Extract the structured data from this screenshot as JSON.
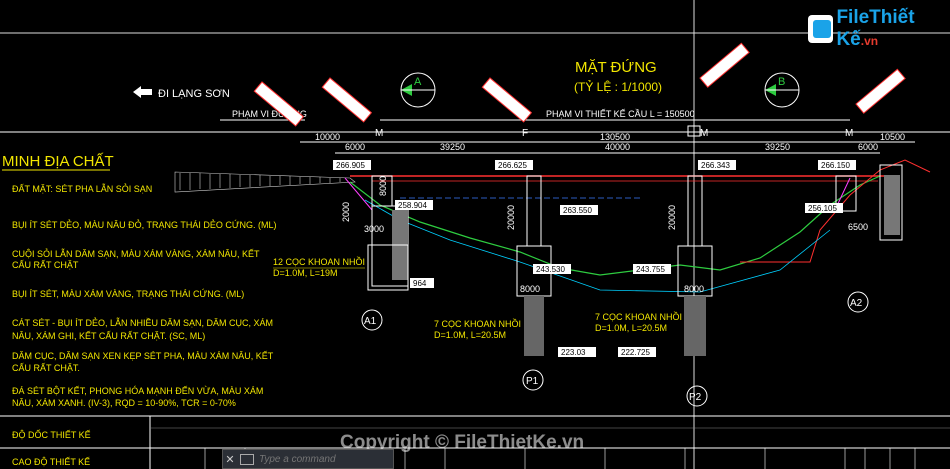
{
  "drawing": {
    "title": "MẶT ĐỨNG",
    "scale": "(TỶ LỆ : 1/1000)",
    "direction": "ĐI LẠNG SƠN",
    "range_road": "PHẠM VI ĐƯỜNG",
    "range_bridge": "PHẠM VI THIẾT KẾ CẦU L = 150500",
    "geology_title": "MINH ĐỊA CHẤT",
    "dims_top": [
      "10000",
      "130500",
      "10500"
    ],
    "dims_second": [
      "6000",
      "39250",
      "40000",
      "39250",
      "6000"
    ],
    "marks": [
      "M",
      "F",
      "M",
      "M"
    ],
    "sections": [
      "A",
      "B"
    ],
    "elevations": [
      "266.905",
      "266.625",
      "266.343",
      "266.150",
      "258.904",
      "256.105",
      "263.550",
      "243.530",
      "243.755"
    ],
    "bottom_elevations": [
      "223.03",
      "222.725"
    ],
    "elev_misc": [
      "964"
    ],
    "vertical_dims": [
      "8000",
      "2000",
      "3000",
      "20000",
      "20000",
      "8000",
      "8000",
      "6500"
    ],
    "piles": [
      {
        "label": "12 CỌC KHOAN NHỒI",
        "spec": "D=1.0M, L=19M"
      },
      {
        "label": "7 CỌC KHOAN NHỒI",
        "spec": "D=1.0M, L=20.5M"
      },
      {
        "label": "7 CỌC KHOAN NHỒI",
        "spec": "D=1.0M, L=20.5M"
      }
    ],
    "supports": [
      "A1",
      "P1",
      "P2",
      "A2"
    ],
    "soil_layers": [
      "ĐẤT MẶT: SÉT PHA LẪN SỎI SẠN",
      "BỤI ÍT SÉT DẺO, MÀU NÂU ĐỎ, TRẠNG THÁI DẺO CỨNG. (ML)",
      "CUỘI SỎI LẪN DĂM SẠN, MÀU XÁM VÀNG, XÁM NÂU, KẾT",
      "CẤU RẤT CHẶT",
      "BỤI ÍT SÉT, MÀU XÁM VÀNG, TRẠNG THÁI CỨNG. (ML)",
      "CÁT SÉT - BỤI ÍT DẺO, LẪN NHIỀU DĂM SẠN, DĂM CỤC, XÁM",
      "NÂU, XÁM GHI, KẾT CẤU RẤT CHẶT. (SC, ML)",
      "DĂM CỤC, DĂM SẠN XEN KẸP SÉT PHA, MÀU XÁM NÂU, KẾT",
      "CẤU RẤT CHẶT.",
      "ĐÁ SÉT BỘT KẾT, PHONG HÓA MẠNH ĐẾN VỪA, MÀU XÁM",
      "NÂU, XÁM XANH. (IV-3), RQD = 10-90%, TCR = 0-70%"
    ],
    "table_rows": [
      "ĐỘ DỐC THIẾT KẾ",
      "CAO ĐỘ THIẾT KẾ"
    ]
  },
  "command": {
    "placeholder": "Type a command"
  },
  "watermark": {
    "logo": "File",
    "logo2": "Thiết Kế",
    "logo_suffix": ".vn",
    "copyright": "Copyright © FileThietKe.vn"
  },
  "colors": {
    "text": "#f2e600",
    "geo": "#ffffff",
    "green": "#2ecc40",
    "red": "#ff3030",
    "cyan": "#00d0ff",
    "magenta": "#ff40ff"
  }
}
